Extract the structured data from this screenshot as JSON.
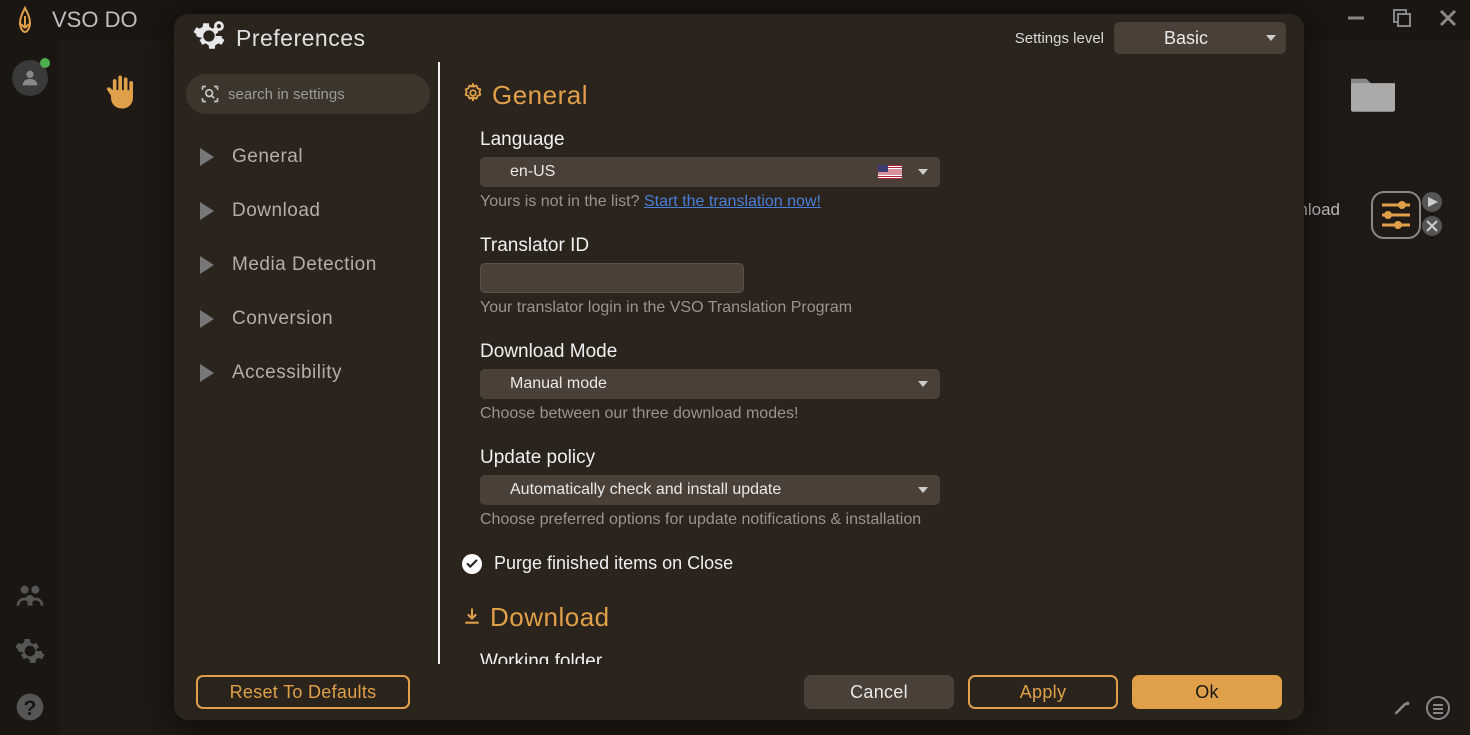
{
  "bg": {
    "title": "VSO DO",
    "download_label": "wnload"
  },
  "modal": {
    "title": "Preferences",
    "settings_level_label": "Settings level",
    "settings_level_value": "Basic",
    "search_placeholder": "search in settings",
    "nav": [
      {
        "label": "General"
      },
      {
        "label": "Download"
      },
      {
        "label": "Media Detection"
      },
      {
        "label": "Conversion"
      },
      {
        "label": "Accessibility"
      }
    ],
    "sections": {
      "general": {
        "title": "General",
        "language": {
          "label": "Language",
          "value": "en-US",
          "hint_prefix": "Yours is not in the list? ",
          "hint_link": "Start the translation now!"
        },
        "translator_id": {
          "label": "Translator ID",
          "value": "",
          "hint": "Your translator login in the VSO Translation Program"
        },
        "download_mode": {
          "label": "Download Mode",
          "value": "Manual mode",
          "hint": "Choose between our three download modes!"
        },
        "update_policy": {
          "label": "Update policy",
          "value": "Automatically check and install update",
          "hint": "Choose preferred options for update notifications & installation"
        },
        "purge": {
          "label": "Purge finished items on Close",
          "checked": true
        }
      },
      "download": {
        "title": "Download",
        "working_folder_label": "Working folder"
      }
    },
    "footer": {
      "reset": "Reset To Defaults",
      "cancel": "Cancel",
      "apply": "Apply",
      "ok": "Ok"
    }
  }
}
